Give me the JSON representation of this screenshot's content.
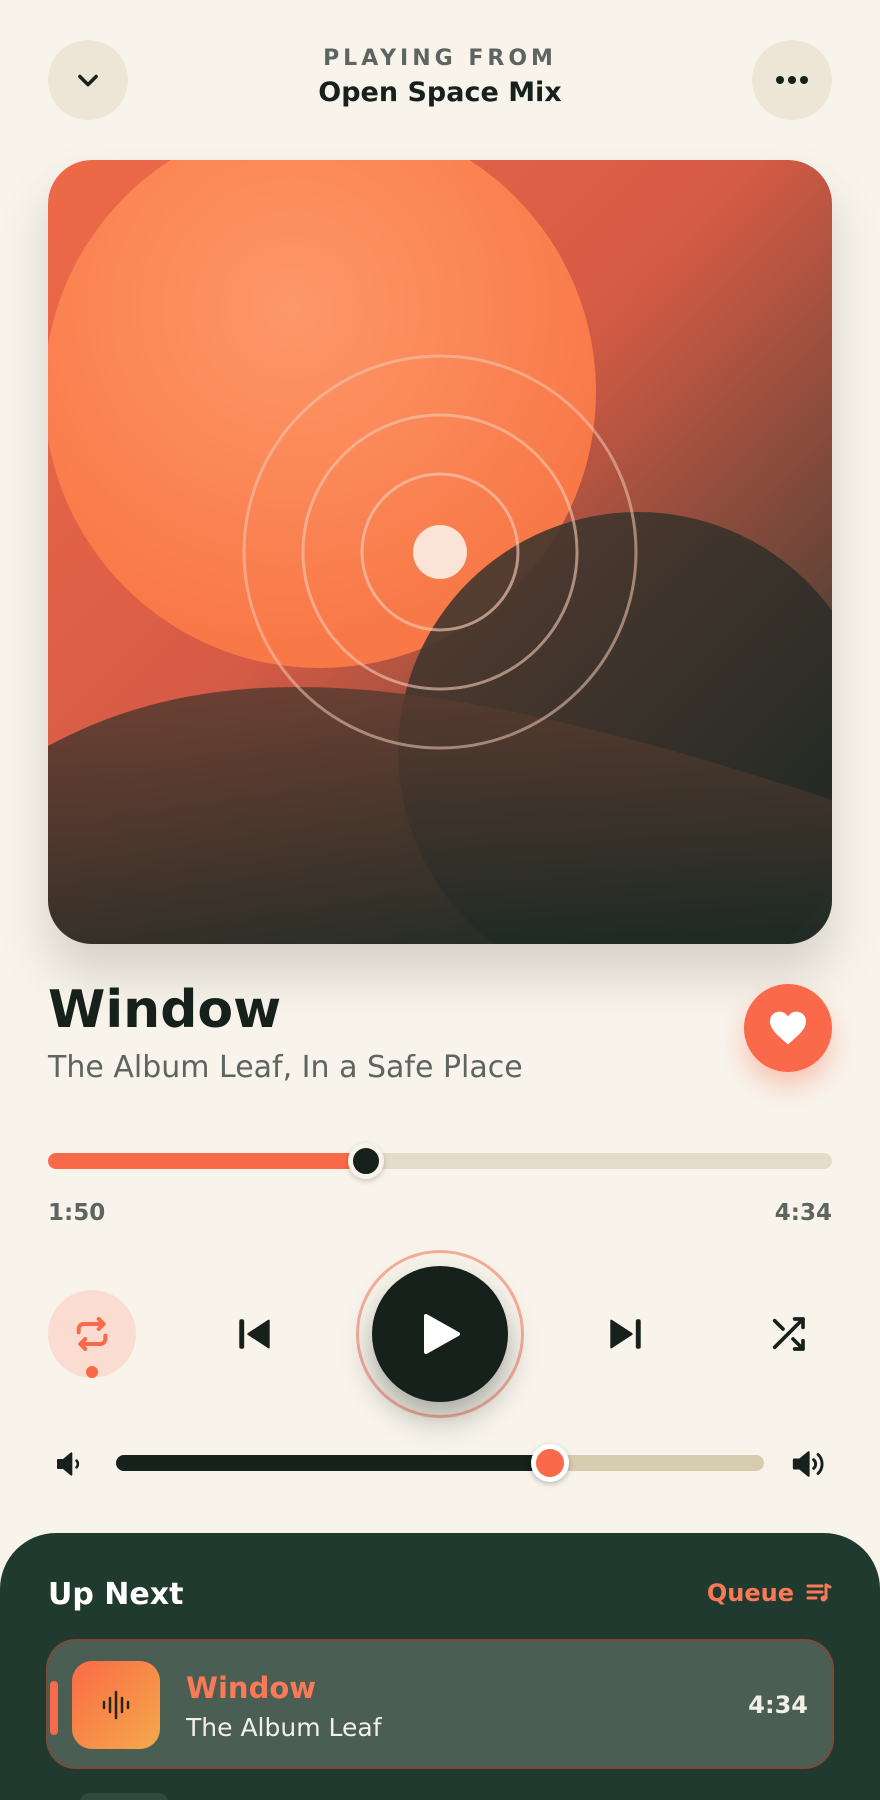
{
  "header": {
    "kicker": "PLAYING FROM",
    "playlist": "Open Space Mix",
    "collapse_icon": "chevron-down-icon",
    "more_icon": "more-horizontal-icon"
  },
  "track": {
    "title": "Window",
    "subtitle": "The Album Leaf, In a Safe Place",
    "liked": true
  },
  "progress": {
    "elapsed": "1:50",
    "duration": "4:34",
    "fraction": 0.405
  },
  "controls": {
    "repeat_active": true,
    "is_playing": false,
    "icons": [
      "repeat-icon",
      "skip-previous-icon",
      "play-icon",
      "skip-next-icon",
      "shuffle-icon"
    ]
  },
  "volume": {
    "level": 0.67,
    "low_icon": "volume-low-icon",
    "high_icon": "volume-high-icon"
  },
  "up_next": {
    "title": "Up Next",
    "queue_label": "Queue",
    "items": [
      {
        "title": "Window",
        "artist": "The Album Leaf",
        "duration": "4:34",
        "active": true
      }
    ]
  },
  "colors": {
    "accent": "#fa6a4a",
    "dark": "#16211c",
    "panel": "#213a30",
    "background": "#f8f4ec"
  }
}
